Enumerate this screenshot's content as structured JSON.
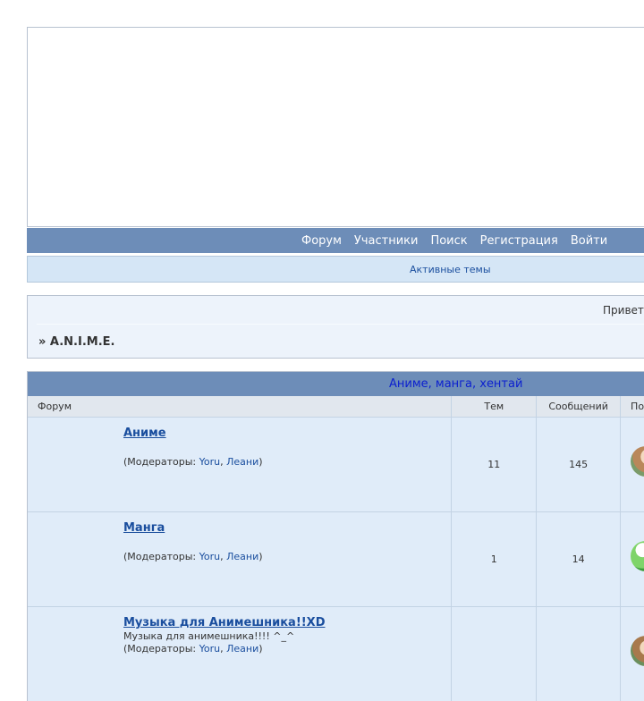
{
  "nav": {
    "items": [
      "Форум",
      "Участники",
      "Поиск",
      "Регистрация",
      "Войти"
    ]
  },
  "active_topics": "Активные темы",
  "greeting": "Привет,",
  "breadcrumb": "» A.N.I.M.E.",
  "category": {
    "title": "Аниме, манга, хентай",
    "columns": [
      "Форум",
      "Тем",
      "Сообщений",
      "По"
    ]
  },
  "forums": [
    {
      "name": "Аниме",
      "description": "",
      "mods_prefix": "(Модераторы: ",
      "mod1": "Yoru",
      "comma": ", ",
      "mod2": "Леани",
      "mods_suffix": ")",
      "topics": "11",
      "posts": "145"
    },
    {
      "name": "Манга",
      "description": "",
      "mods_prefix": "(Модераторы: ",
      "mod1": "Yoru",
      "comma": ", ",
      "mod2": "Леани",
      "mods_suffix": ")",
      "topics": "1",
      "posts": "14"
    },
    {
      "name": "Музыка для Анимешника!!XD",
      "description": "Музыка для анимешника!!!! ^_^",
      "mods_prefix": "(Модераторы: ",
      "mod1": "Yoru",
      "comma": ", ",
      "mod2": "Леани",
      "mods_suffix": ")",
      "topics": "",
      "posts": ""
    }
  ],
  "colors": {
    "nav_bar": "#6d8db8",
    "row_bg": "#e0ecf9",
    "link": "#1a4e9e",
    "category_title": "#0b1fcf"
  }
}
